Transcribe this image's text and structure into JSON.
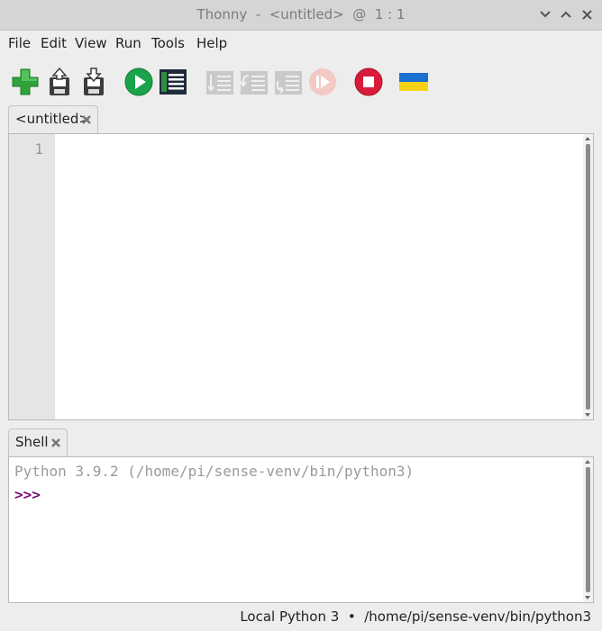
{
  "window": {
    "title": "Thonny  -  <untitled>  @  1 : 1"
  },
  "menu": {
    "items": [
      "File",
      "Edit",
      "View",
      "Run",
      "Tools",
      "Help"
    ]
  },
  "toolbar": {
    "buttons": [
      {
        "name": "new-file",
        "icon": "plus-icon",
        "enabled": true
      },
      {
        "name": "open-file",
        "icon": "open-icon",
        "enabled": true
      },
      {
        "name": "save-file",
        "icon": "save-icon",
        "enabled": true
      },
      {
        "name": "run",
        "icon": "play-icon",
        "enabled": true
      },
      {
        "name": "debug",
        "icon": "debug-icon",
        "enabled": true
      },
      {
        "name": "step-over",
        "icon": "step-over-icon",
        "enabled": false
      },
      {
        "name": "step-into",
        "icon": "step-into-icon",
        "enabled": false
      },
      {
        "name": "step-out",
        "icon": "step-out-icon",
        "enabled": false
      },
      {
        "name": "resume",
        "icon": "resume-icon",
        "enabled": false
      },
      {
        "name": "stop",
        "icon": "stop-icon",
        "enabled": true
      },
      {
        "name": "flag",
        "icon": "ukraine-flag-icon",
        "enabled": true
      }
    ]
  },
  "editor": {
    "tab_label": "<untitled>",
    "line_numbers": [
      "1"
    ],
    "content": ""
  },
  "shell": {
    "tab_label": "Shell",
    "banner": "Python 3.9.2 (/home/pi/sense-venv/bin/python3)",
    "prompt": ">>>"
  },
  "status": {
    "interpreter": "Local Python 3  •  /home/pi/sense-venv/bin/python3"
  },
  "colors": {
    "run_green": "#1aa34a",
    "stop_red": "#d81b3a",
    "prompt_purple": "#7a0f7a",
    "disabled_gray": "#b9b9b9"
  }
}
